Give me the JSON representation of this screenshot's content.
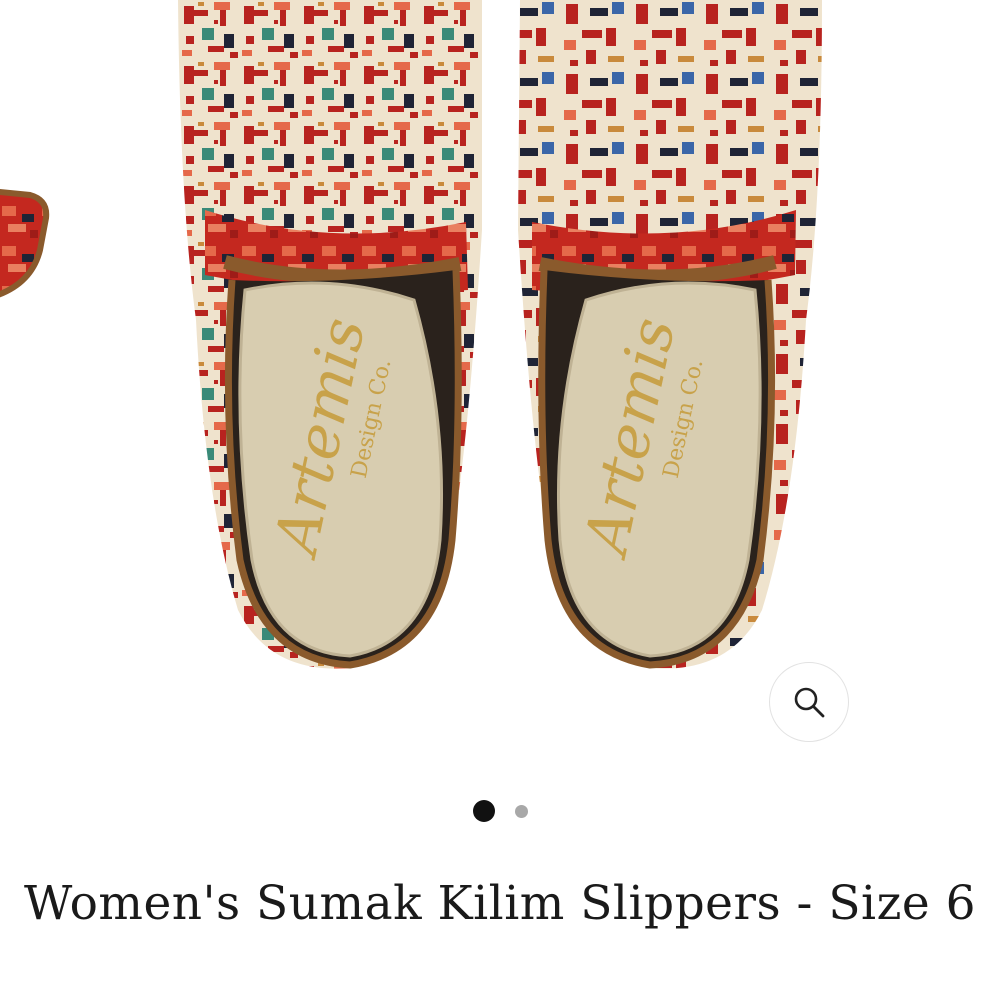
{
  "product": {
    "title": "Women's Sumak Kilim Slippers - Size 6",
    "insole_brand": "Artemis",
    "insole_brand_sub": "Design Co."
  },
  "gallery": {
    "slide_count": 2,
    "active_slide": 1,
    "zoom_icon": "search-icon"
  },
  "colors": {
    "kilim_red": "#b8231f",
    "kilim_cream": "#efe3cd",
    "kilim_coral": "#e5694a",
    "kilim_teal": "#3a8a78",
    "kilim_navy": "#1f2436",
    "insole": "#d8cdb0",
    "piping": "#8a5a2c",
    "dot_active": "#111111",
    "dot_inactive": "#a8a8a8"
  }
}
